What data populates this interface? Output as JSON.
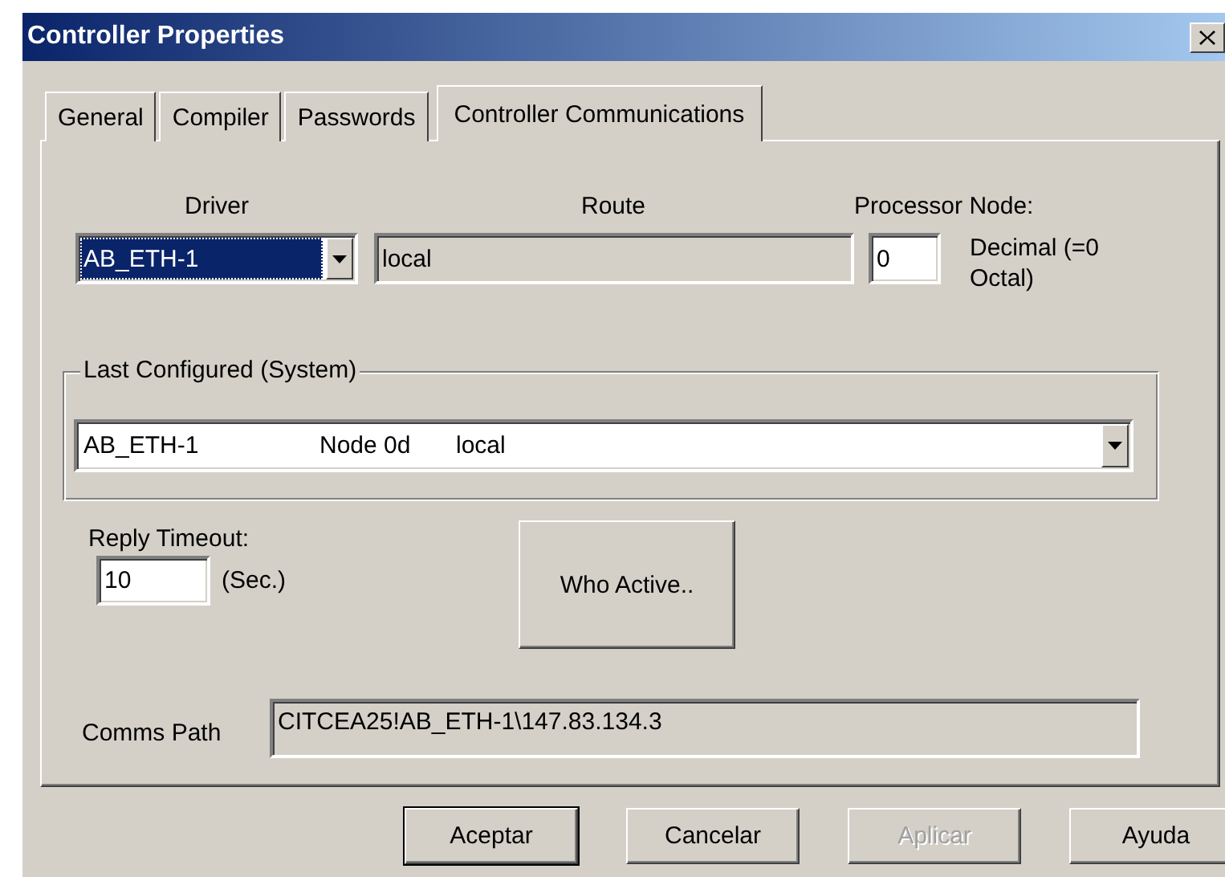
{
  "window": {
    "title": "Controller Properties"
  },
  "tabs": [
    {
      "label": "General",
      "selected": false
    },
    {
      "label": "Compiler",
      "selected": false
    },
    {
      "label": "Passwords",
      "selected": false
    },
    {
      "label": "Controller Communications",
      "selected": true
    }
  ],
  "driver": {
    "label": "Driver",
    "value": "AB_ETH-1",
    "focused": true
  },
  "route": {
    "label": "Route",
    "value": "local",
    "disabled": true
  },
  "processor_node": {
    "label": "Processor Node:",
    "value": "0",
    "note": "Decimal (=0 Octal)"
  },
  "last_configured": {
    "legend": "Last Configured (System)",
    "columns": [
      "AB_ETH-1",
      "Node 0d",
      "local"
    ]
  },
  "reply_timeout": {
    "label": "Reply Timeout:",
    "value": "10",
    "unit": "(Sec.)"
  },
  "who_active": {
    "label": "Who Active.."
  },
  "comms_path": {
    "label": "Comms Path",
    "value": "CITCEA25!AB_ETH-1\\147.83.134.3",
    "disabled": true
  },
  "buttons": [
    {
      "label": "Aceptar",
      "default": true,
      "disabled": false
    },
    {
      "label": "Cancelar",
      "default": false,
      "disabled": false
    },
    {
      "label": "Aplicar",
      "default": false,
      "disabled": true
    },
    {
      "label": "Ayuda",
      "default": false,
      "disabled": false
    }
  ]
}
